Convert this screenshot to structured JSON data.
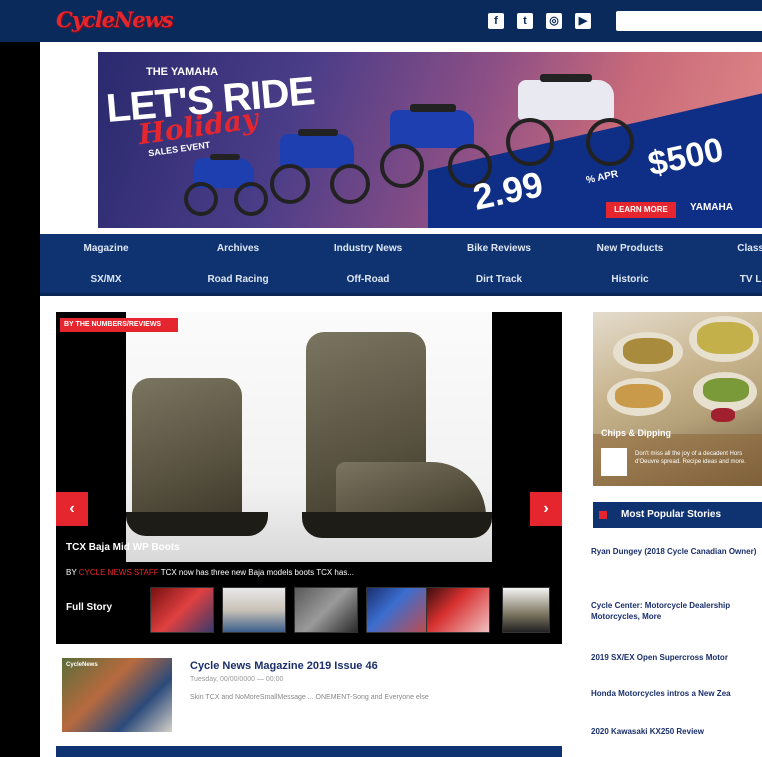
{
  "header": {
    "logo": "CycleNews",
    "social_icons": [
      "facebook-icon",
      "twitter-icon",
      "instagram-icon",
      "youtube-icon"
    ],
    "search_placeholder": ""
  },
  "banner": {
    "small": "THE YAMAHA",
    "big": "LET'S RIDE",
    "script": "Holiday",
    "sub": "SALES EVENT",
    "apr": "2.99",
    "apr_small": "% APR",
    "cash": "$500",
    "button": "LEARN MORE",
    "brand": "YAMAHA"
  },
  "nav": {
    "row1": [
      "Magazine",
      "Archives",
      "Industry News",
      "Bike Reviews",
      "New Products",
      "Classi"
    ],
    "row2": [
      "SX/MX",
      "Road Racing",
      "Off-Road",
      "Dirt Track",
      "Historic",
      "TV Li"
    ]
  },
  "featured": {
    "badge": "BY THE NUMBERS/REVIEWS",
    "title": "TCX Baja Mid WP Boots",
    "meta_prefix": "BY",
    "meta_author": "CYCLE NEWS STAFF",
    "meta_text": "TCX now has three new Baja models boots TCX has...",
    "full_story": "Full Story",
    "prev": "‹",
    "next": "›"
  },
  "news": {
    "thumb_tag": "CycleNews",
    "title": "Cycle News Magazine 2019 Issue 46",
    "date": "Tuesday, 00/00/0000 — 00:00",
    "desc": "Skin TCX and NoMoreSmallMessage ... ONEMENT-Song and Everyone else"
  },
  "ad": {
    "title": "Chips & Dipping",
    "text": "Don't miss all the joy of a decadent Hors d'Oeuvre spread. Recipe ideas and more."
  },
  "most_popular": {
    "title": "Most Popular Stories",
    "items": [
      "Ryan Dungey (2018 Cycle Canadian Owner)",
      "Cycle Center: Motorcycle Dealership Motorcycles, More",
      "2019 SX/EX Open Supercross Motor",
      "Honda Motorcycles intros a New Zea",
      "2020 Kawasaki KX250 Review"
    ]
  }
}
